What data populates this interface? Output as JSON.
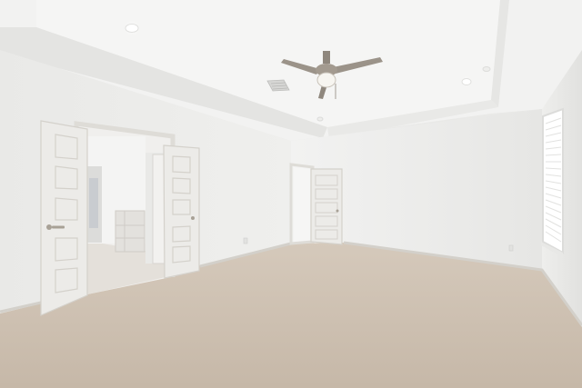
{
  "scene": {
    "subject": "empty-carpeted-bedroom",
    "colors": {
      "ceiling": "#f3f3f2",
      "wall_light": "#f1f1f0",
      "wall_shade": "#e2e2e0",
      "carpet": "#cdbfb0",
      "door": "#ecebe8",
      "trim": "#dedcd7",
      "fan_metal": "#9b9389",
      "bath_floor": "#e4e0da"
    }
  }
}
